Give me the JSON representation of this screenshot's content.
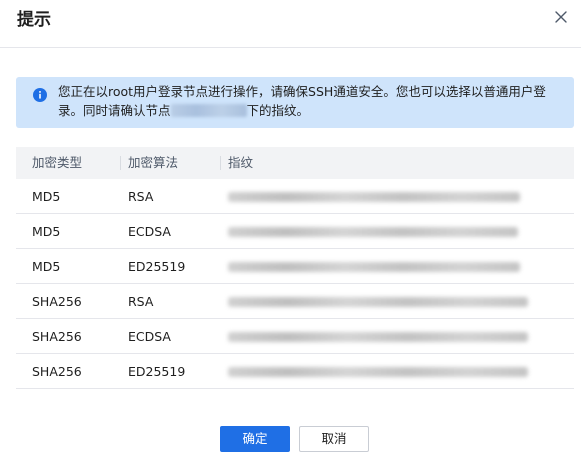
{
  "dialog": {
    "title": "提示",
    "close_icon": "close-icon"
  },
  "alert": {
    "icon": "info-icon",
    "text_before": "您正在以root用户登录节点进行操作，请确保SSH通道安全。您也可以选择以普通用户登录。同时请确认节点",
    "text_after": "下的指纹。",
    "color": "#cfe4fb"
  },
  "table": {
    "headers": [
      "加密类型",
      "加密算法",
      "指纹"
    ],
    "rows": [
      {
        "type": "MD5",
        "algo": "RSA"
      },
      {
        "type": "MD5",
        "algo": "ECDSA"
      },
      {
        "type": "MD5",
        "algo": "ED25519"
      },
      {
        "type": "SHA256",
        "algo": "RSA"
      },
      {
        "type": "SHA256",
        "algo": "ECDSA"
      },
      {
        "type": "SHA256",
        "algo": "ED25519"
      }
    ]
  },
  "footer": {
    "ok_label": "确定",
    "cancel_label": "取消",
    "primary_color": "#1f6fe5"
  }
}
